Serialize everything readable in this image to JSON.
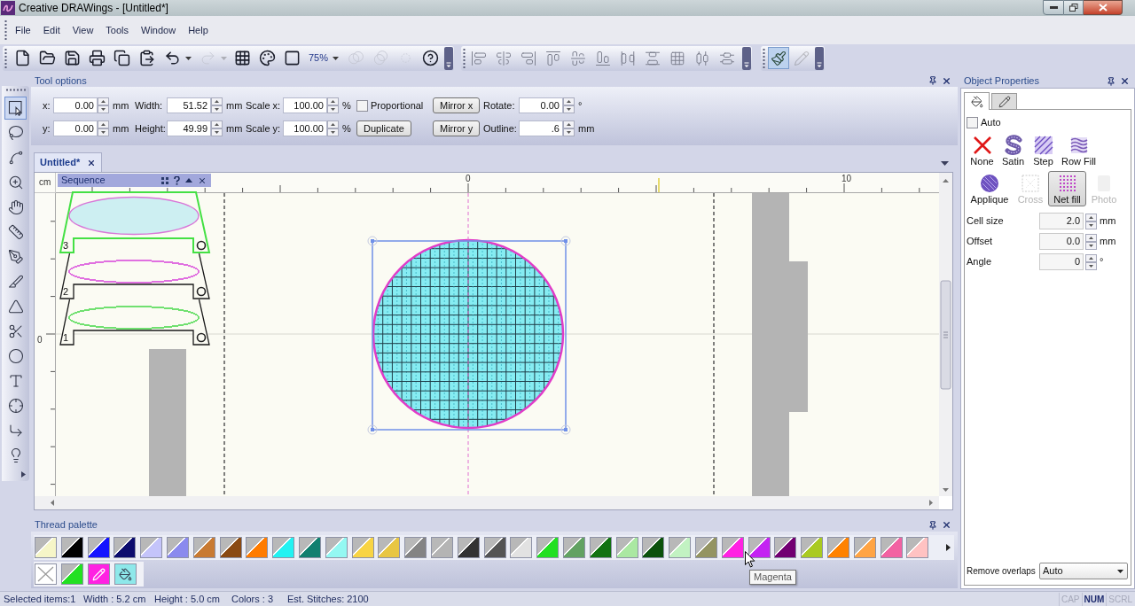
{
  "window": {
    "title": "Creative DRAWings - [Untitled*]"
  },
  "menu": [
    "File",
    "Edit",
    "View",
    "Tools",
    "Window",
    "Help"
  ],
  "toolbar": {
    "items": [
      {
        "kind": "new",
        "disabled": false
      },
      {
        "kind": "open",
        "disabled": false
      },
      {
        "kind": "save",
        "disabled": false
      },
      {
        "kind": "print",
        "disabled": false
      },
      {
        "kind": "copy",
        "disabled": false
      },
      {
        "kind": "paste",
        "disabled": false
      },
      {
        "kind": "undo",
        "disabled": false
      },
      {
        "kind": "redo",
        "disabled": true
      },
      {
        "kind": "grid",
        "disabled": false
      },
      {
        "kind": "palette",
        "disabled": false
      },
      {
        "kind": "frame",
        "disabled": false
      },
      {
        "kind": "zoom",
        "label": "75%"
      },
      {
        "kind": "weld",
        "disabled": true
      },
      {
        "kind": "combine",
        "disabled": true
      },
      {
        "kind": "trim",
        "disabled": true
      },
      {
        "kind": "help",
        "disabled": false
      }
    ],
    "draw_tools": [
      {
        "kind": "brush",
        "selected": true,
        "disabled": false
      },
      {
        "kind": "pen",
        "selected": false,
        "disabled": true
      }
    ]
  },
  "tools": [
    {
      "kind": "select",
      "selected": true
    },
    {
      "kind": "lasso",
      "selected": false
    },
    {
      "kind": "spline",
      "selected": false
    },
    {
      "kind": "zoom",
      "selected": false
    },
    {
      "kind": "pan",
      "selected": false
    },
    {
      "kind": "measure",
      "selected": false
    },
    {
      "kind": "pen",
      "selected": false
    },
    {
      "kind": "knife",
      "selected": false
    },
    {
      "kind": "shape",
      "selected": false
    },
    {
      "kind": "cut",
      "selected": false
    },
    {
      "kind": "ellipse",
      "selected": false
    },
    {
      "kind": "text",
      "selected": false
    },
    {
      "kind": "center",
      "selected": false
    },
    {
      "kind": "corner",
      "selected": false
    },
    {
      "kind": "light",
      "selected": false
    }
  ],
  "tool_options": {
    "title": "Tool options",
    "rows": [
      [
        {
          "kind": "spin",
          "label": "x:",
          "value": "0.00",
          "unit": "mm"
        },
        {
          "kind": "spin",
          "label": "Width:",
          "value": "51.52",
          "unit": "mm"
        },
        {
          "kind": "spin",
          "label": "Scale x:",
          "value": "100.00",
          "unit": "%"
        },
        {
          "kind": "checkbox",
          "label": "Proportional",
          "checked": false
        },
        {
          "kind": "button",
          "label": "Mirror x"
        },
        {
          "kind": "spin",
          "label": "Rotate:",
          "value": "0.00",
          "unit": "°"
        }
      ],
      [
        {
          "kind": "spin",
          "label": "y:",
          "value": "0.00",
          "unit": "mm"
        },
        {
          "kind": "spin",
          "label": "Height:",
          "value": "49.99",
          "unit": "mm"
        },
        {
          "kind": "spin",
          "label": "Scale y:",
          "value": "100.00",
          "unit": "%"
        },
        {
          "kind": "button",
          "label": "Duplicate"
        },
        {
          "kind": "button",
          "label": "Mirror y"
        },
        {
          "kind": "spin",
          "label": "Outline:",
          "value": ".6",
          "unit": "mm"
        }
      ]
    ]
  },
  "document_tab": {
    "title": "Untitled*"
  },
  "canvas": {
    "ruler_unit": "cm",
    "top_ruler_labels": [
      "0",
      "10"
    ],
    "left_ruler_labels": [
      "0"
    ]
  },
  "sequence": {
    "title": "Sequence",
    "items": [
      {
        "number": "3",
        "selected": true,
        "kind": "fill",
        "color": "#cdeff2"
      },
      {
        "number": "2",
        "selected": false,
        "kind": "outline",
        "color": "#e070e0"
      },
      {
        "number": "1",
        "selected": false,
        "kind": "outline",
        "color": "#70e070"
      }
    ]
  },
  "thread_palette": {
    "title": "Thread palette",
    "swatches": [
      {
        "color": "#f6f6c8"
      },
      {
        "color": "#000000"
      },
      {
        "color": "#1414ff"
      },
      {
        "color": "#0c0c6e"
      },
      {
        "color": "#c4c4fa"
      },
      {
        "color": "#8a8aee"
      },
      {
        "color": "#c87a32"
      },
      {
        "color": "#8a4a12"
      },
      {
        "color": "#ff7c00"
      },
      {
        "color": "#22f2f2"
      },
      {
        "color": "#128070"
      },
      {
        "color": "#94f8f2"
      },
      {
        "color": "#f8d444"
      },
      {
        "color": "#e8c642"
      },
      {
        "color": "#848484"
      },
      {
        "color": "#b4b4b4"
      },
      {
        "color": "#323232"
      },
      {
        "color": "#545454"
      },
      {
        "color": "#e2e2e2"
      },
      {
        "color": "#22e022"
      },
      {
        "color": "#62a262"
      },
      {
        "color": "#127212"
      },
      {
        "color": "#aae8a2"
      },
      {
        "color": "#0c520c"
      },
      {
        "color": "#c2f2c2"
      },
      {
        "color": "#949462"
      },
      {
        "color": "#ff22e2"
      },
      {
        "color": "#c422f2"
      },
      {
        "color": "#720072"
      },
      {
        "color": "#aaca22"
      },
      {
        "color": "#ff8200"
      },
      {
        "color": "#ffa444"
      },
      {
        "color": "#f262a2"
      },
      {
        "color": "#ffc2c2"
      }
    ],
    "design_colors": [
      {
        "kind": "none"
      },
      {
        "kind": "swatch",
        "color": "#22e022"
      },
      {
        "kind": "outline",
        "color": "#ff22e2"
      },
      {
        "kind": "fill",
        "color": "#8ee8ea"
      }
    ],
    "tooltip": "Magenta"
  },
  "object_properties": {
    "title": "Object Properties",
    "tabs": [
      {
        "kind": "fill",
        "selected": true
      },
      {
        "kind": "outline",
        "selected": false
      }
    ],
    "auto": {
      "label": "Auto",
      "checked": false
    },
    "fill_types": [
      {
        "kind": "none",
        "label": "None",
        "selected": false,
        "disabled": false
      },
      {
        "kind": "satin",
        "label": "Satin",
        "selected": false,
        "disabled": false
      },
      {
        "kind": "step",
        "label": "Step",
        "selected": false,
        "disabled": false
      },
      {
        "kind": "row_fill",
        "label": "Row Fill",
        "selected": false,
        "disabled": false
      },
      {
        "kind": "applique",
        "label": "Applique",
        "selected": false,
        "disabled": false
      },
      {
        "kind": "cross",
        "label": "Cross",
        "selected": false,
        "disabled": true
      },
      {
        "kind": "net_fill",
        "label": "Net fill",
        "selected": true,
        "disabled": false
      },
      {
        "kind": "photo",
        "label": "Photo",
        "selected": false,
        "disabled": true
      }
    ],
    "settings": [
      {
        "label": "Cell size",
        "value": "2.0",
        "unit": "mm"
      },
      {
        "label": "Offset",
        "value": "0.0",
        "unit": "mm"
      },
      {
        "label": "Angle",
        "value": "0",
        "unit": "°"
      }
    ],
    "remove_overlaps": {
      "label": "Remove overlaps",
      "value": "Auto"
    }
  },
  "status_bar": {
    "items": [
      "Selected items:1",
      "Width : 5.2 cm",
      "Height : 5.0 cm",
      "Colors : 3",
      "Est. Stitches: 2100"
    ],
    "indicators": [
      {
        "label": "CAP",
        "on": false
      },
      {
        "label": "NUM",
        "on": true
      },
      {
        "label": "SCRL",
        "on": false
      }
    ]
  }
}
